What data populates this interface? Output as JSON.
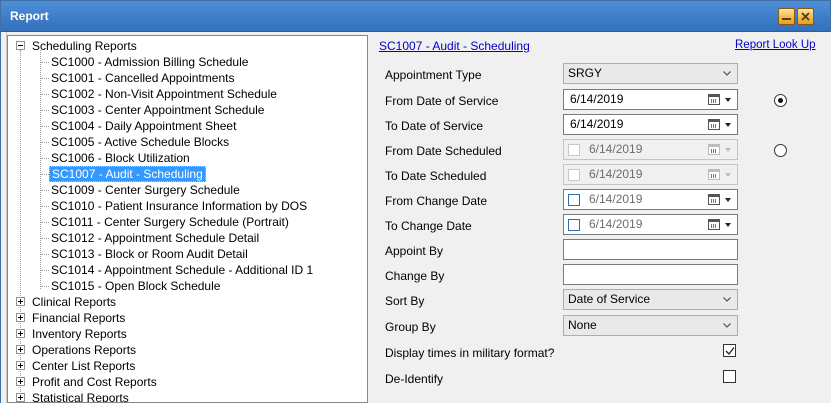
{
  "window": {
    "title": "Report"
  },
  "tree": {
    "root": {
      "label": "Scheduling Reports",
      "children": [
        "SC1000 - Admission Billing Schedule",
        "SC1001 - Cancelled Appointments",
        "SC1002 - Non-Visit Appointment Schedule",
        "SC1003 - Center Appointment Schedule",
        "SC1004 - Daily Appointment Sheet",
        "SC1005 - Active Schedule Blocks",
        "SC1006 - Block Utilization",
        "SC1007 - Audit - Scheduling",
        "SC1009 - Center Surgery Schedule",
        "SC1010 - Patient Insurance Information by DOS",
        "SC1011 - Center Surgery Schedule (Portrait)",
        "SC1012 - Appointment Schedule Detail",
        "SC1013 - Block or Room Audit Detail",
        "SC1014 - Appointment Schedule - Additional ID 1",
        "SC1015 - Open Block Schedule"
      ],
      "selected": "SC1007 - Audit - Scheduling"
    },
    "collapsed": [
      "Clinical Reports",
      "Financial Reports",
      "Inventory Reports",
      "Operations Reports",
      "Center List Reports",
      "Profit and Cost Reports",
      "Statistical Reports"
    ]
  },
  "panel": {
    "report_title": "SC1007 - Audit - Scheduling",
    "lookup_link": "Report Look Up",
    "fields": {
      "appointment_type": {
        "label": "Appointment Type",
        "value": "SRGY"
      },
      "from_date_of_service": {
        "label": "From Date of Service",
        "value": "6/14/2019"
      },
      "to_date_of_service": {
        "label": "To Date of Service",
        "value": "6/14/2019"
      },
      "from_date_scheduled": {
        "label": "From Date Scheduled",
        "value": "6/14/2019"
      },
      "to_date_scheduled": {
        "label": "To Date Scheduled",
        "value": "6/14/2019"
      },
      "from_change_date": {
        "label": "From Change Date",
        "value": "6/14/2019"
      },
      "to_change_date": {
        "label": "To Change Date",
        "value": "6/14/2019"
      },
      "appoint_by": {
        "label": "Appoint By",
        "value": ""
      },
      "change_by": {
        "label": "Change By",
        "value": ""
      },
      "sort_by": {
        "label": "Sort By",
        "value": "Date of Service"
      },
      "group_by": {
        "label": "Group By",
        "value": "None"
      },
      "military_time": {
        "label": "Display times in military format?",
        "checked": true
      },
      "de_identify": {
        "label": "De-Identify",
        "checked": false
      }
    },
    "date_mode": {
      "service_selected": true,
      "scheduled_selected": false
    }
  },
  "icons": {
    "minimize": "minimize-icon",
    "close": "close-icon",
    "calendar": "calendar-icon",
    "dropdown": "chevron-down-icon"
  },
  "colors": {
    "titlebar": "#3c7bc7",
    "selection": "#3399ff",
    "link": "#0000cc"
  }
}
